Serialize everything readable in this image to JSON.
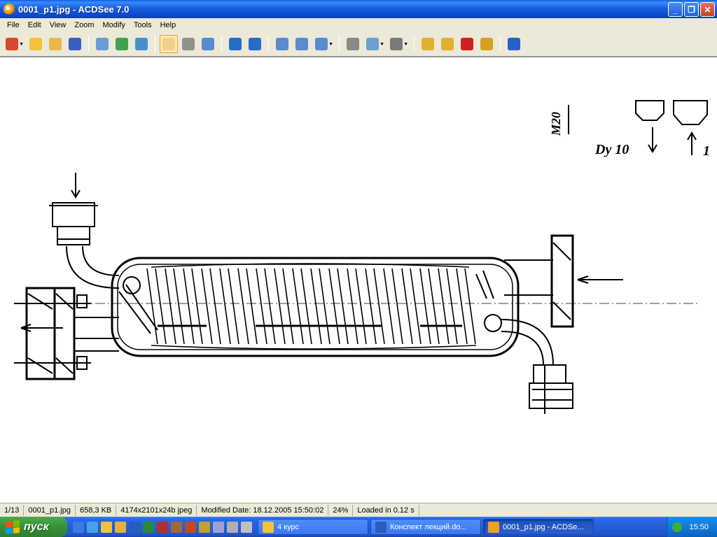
{
  "window": {
    "title": "0001_p1.jpg - ACDSee 7.0",
    "buttons": {
      "minimize": "_",
      "maximize": "❐",
      "close": "✕"
    }
  },
  "menu": [
    "File",
    "Edit",
    "View",
    "Zoom",
    "Modify",
    "Tools",
    "Help"
  ],
  "toolbar": {
    "groups": [
      [
        {
          "name": "acquire-icon",
          "color": "#d84830",
          "drop": true
        },
        {
          "name": "browse-folder-icon",
          "color": "#f2c23a"
        },
        {
          "name": "open-icon",
          "color": "#e9b84a"
        },
        {
          "name": "save-icon",
          "color": "#3a5fbf"
        }
      ],
      [
        {
          "name": "previous-image-icon",
          "color": "#6c9bd8"
        },
        {
          "name": "next-image-icon",
          "color": "#3fa34d"
        },
        {
          "name": "slideshow-icon",
          "color": "#4a90c8"
        }
      ],
      [
        {
          "name": "hand-tool-icon",
          "color": "#f0d090",
          "active": true
        },
        {
          "name": "select-icon",
          "color": "#909090"
        },
        {
          "name": "zoom-tool-icon",
          "color": "#5a8ad0"
        }
      ],
      [
        {
          "name": "rotate-left-icon",
          "color": "#2a6ac8"
        },
        {
          "name": "rotate-right-icon",
          "color": "#2a6ac8"
        }
      ],
      [
        {
          "name": "zoom-in-icon",
          "color": "#5a8ad0"
        },
        {
          "name": "zoom-out-icon",
          "color": "#5a8ad0"
        },
        {
          "name": "zoom-mode-icon",
          "color": "#5a8ad0",
          "drop": true
        }
      ],
      [
        {
          "name": "print-icon",
          "color": "#8a8a8a"
        },
        {
          "name": "share-icon",
          "color": "#6aa0d0",
          "drop": true
        },
        {
          "name": "burn-icon",
          "color": "#7a7a7a",
          "drop": true
        }
      ],
      [
        {
          "name": "copy-to-folder-icon",
          "color": "#e0b030"
        },
        {
          "name": "move-to-folder-icon",
          "color": "#e0b030"
        },
        {
          "name": "delete-icon",
          "color": "#d02020"
        },
        {
          "name": "properties-icon",
          "color": "#d8a020"
        }
      ],
      [
        {
          "name": "help-icon",
          "color": "#2a5fc8"
        }
      ]
    ]
  },
  "drawing": {
    "labels": {
      "thread": "M20",
      "nominal": "Dy 10",
      "mark": "1"
    }
  },
  "status": {
    "index": "1/13",
    "filename": "0001_p1.jpg",
    "filesize": "658,3 KB",
    "dimensions": "4174x2101x24b jpeg",
    "modified": "Modified Date: 18.12.2005 15:50:02",
    "zoom": "24%",
    "load_time": "Loaded in 0.12 s"
  },
  "taskbar": {
    "start_label": "пуск",
    "quick_launch": [
      {
        "name": "ie-icon",
        "color": "#3a7de0"
      },
      {
        "name": "desktop-icon",
        "color": "#4aa0e8"
      },
      {
        "name": "media-icon",
        "color": "#f0c040"
      },
      {
        "name": "outlook-icon",
        "color": "#e8b040"
      },
      {
        "name": "word-icon",
        "color": "#2a5cc0"
      },
      {
        "name": "excel-icon",
        "color": "#2a8a3a"
      },
      {
        "name": "access-icon",
        "color": "#b03030"
      },
      {
        "name": "app1-icon",
        "color": "#9c6a3a"
      },
      {
        "name": "app2-icon",
        "color": "#c04a20"
      },
      {
        "name": "app3-icon",
        "color": "#c0a030"
      },
      {
        "name": "app4-icon",
        "color": "#a0a0d0"
      },
      {
        "name": "app5-icon",
        "color": "#b0b0b0"
      },
      {
        "name": "app6-icon",
        "color": "#c0c0c0"
      }
    ],
    "tasks": [
      {
        "label": "4 курс",
        "icon": "folder-icon",
        "color": "#f2c23a",
        "active": false
      },
      {
        "label": "Конспект лекций.do...",
        "icon": "word-doc-icon",
        "color": "#2a5cc0",
        "active": false
      },
      {
        "label": "0001_p1.jpg - ACDSe...",
        "icon": "acdsee-icon",
        "color": "#f0a020",
        "active": true
      }
    ],
    "clock": "15:50"
  }
}
